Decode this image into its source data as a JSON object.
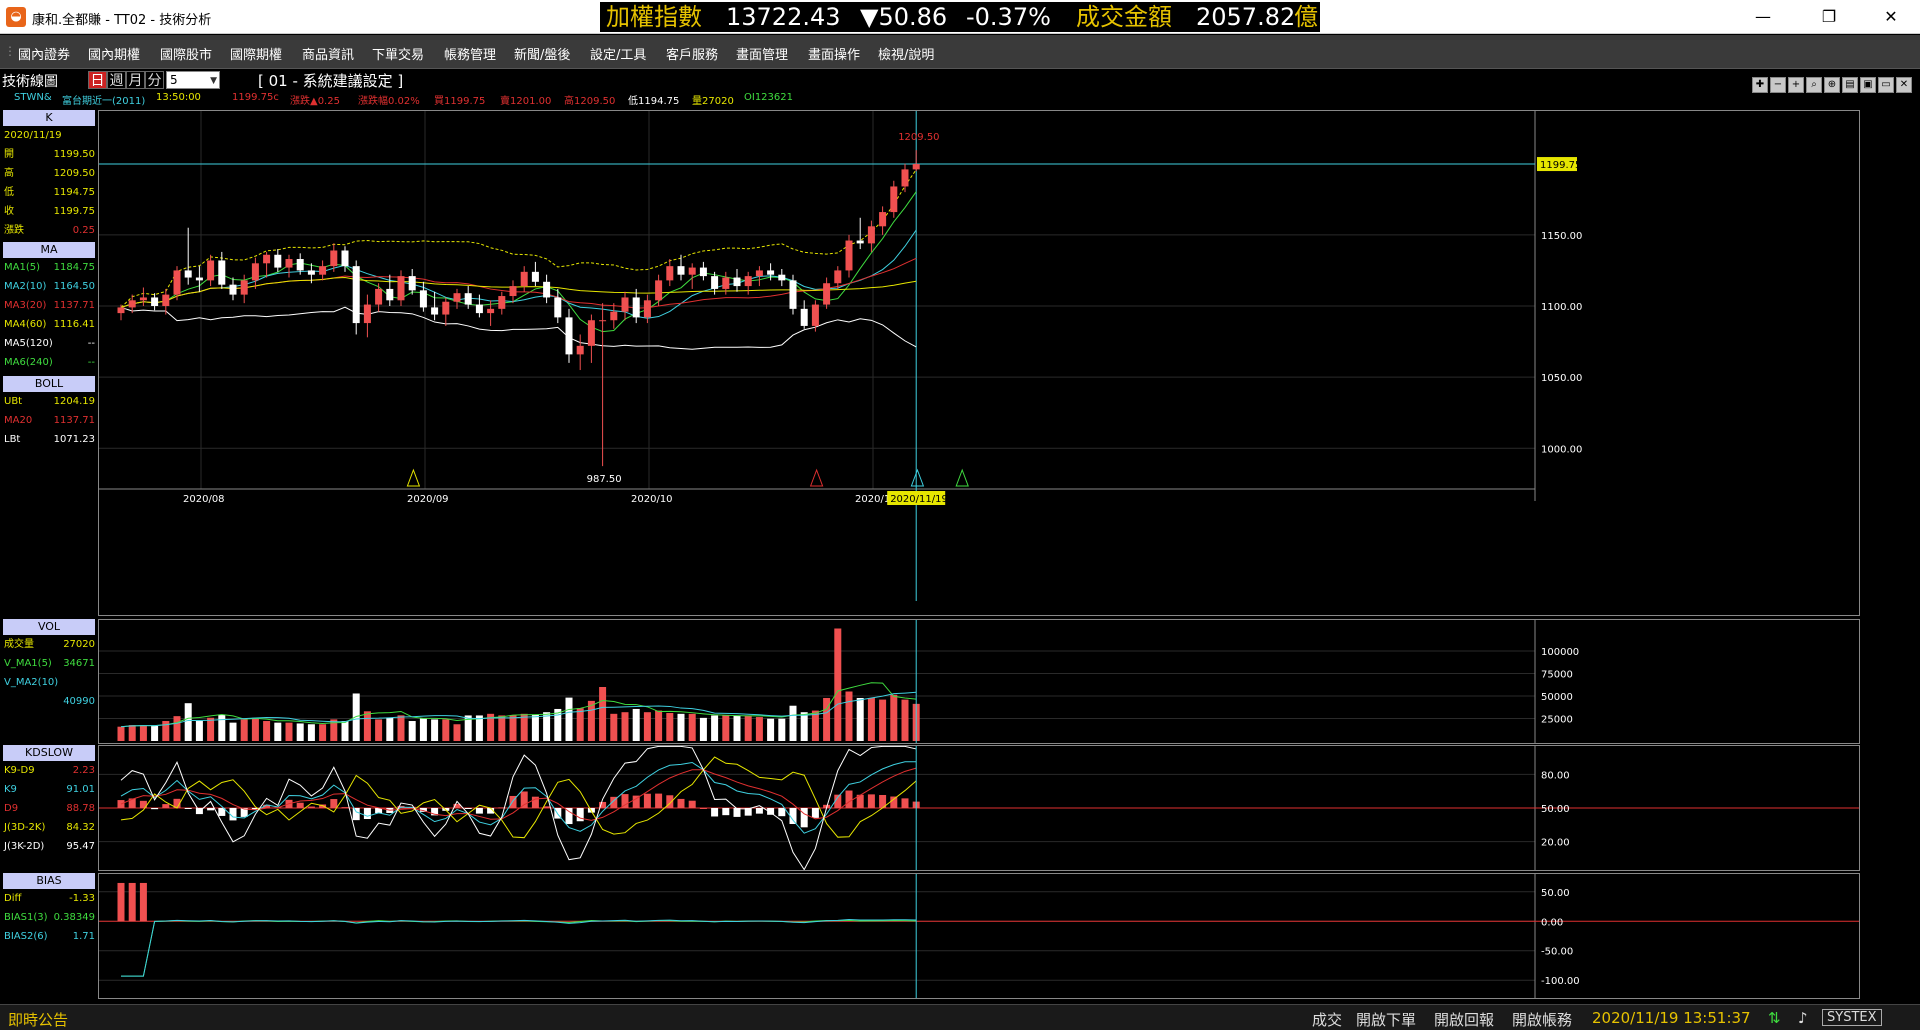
{
  "window": {
    "title": "康和.全都賺 - TT02 - 技術分析",
    "app_icon": "app-logo-icon",
    "controls": {
      "minimize": "—",
      "restore": "❐",
      "close": "✕"
    }
  },
  "ticker": {
    "index_name": "加權指數",
    "index_value": "13722.43",
    "change": "▼50.86",
    "change_pct": "-0.37%",
    "volume_label": "成交金額",
    "volume_value": "2057.82",
    "volume_unit": "億"
  },
  "menu": [
    "國內證券",
    "國內期權",
    "國際股市",
    "國際期權",
    "商品資訊",
    "下單交易",
    "帳務管理",
    "新聞/盤後",
    "設定/工具",
    "客戶服務",
    "畫面管理",
    "畫面操作",
    "檢視/說明"
  ],
  "toolbar": {
    "title": "技術線圖",
    "periods": [
      "日",
      "週",
      "月",
      "分"
    ],
    "selected_period": "日",
    "minute_value": "5",
    "setting": "[ 01 - 系統建議設定 ]"
  },
  "info": {
    "symbol": "STWN&",
    "name": "富台期近一(2011)",
    "time": "13:50:00",
    "price": "1199.75c",
    "chg": "漲跌▲0.25",
    "chg_pct": "漲跌幅0.02%",
    "bid": "買1199.75",
    "ask": "賣1201.00",
    "high": "高1209.50",
    "low": "低1194.75",
    "vol": "量27020",
    "oi": "OI123621"
  },
  "panel_k": {
    "head": "K",
    "date": "2020/11/19",
    "rows": [
      {
        "label": "開",
        "value": "1199.50"
      },
      {
        "label": "高",
        "value": "1209.50"
      },
      {
        "label": "低",
        "value": "1194.75"
      },
      {
        "label": "收",
        "value": "1199.75"
      },
      {
        "label": "漲跌",
        "value": "0.25"
      }
    ]
  },
  "panel_ma": {
    "head": "MA",
    "rows": [
      {
        "label": "MA1(5)",
        "value": "1184.75",
        "color": "#3fdc3f"
      },
      {
        "label": "MA2(10)",
        "value": "1164.50",
        "color": "#3fd0e0"
      },
      {
        "label": "MA3(20)",
        "value": "1137.71",
        "color": "#e03030"
      },
      {
        "label": "MA4(60)",
        "value": "1116.41",
        "color": "#e6e600"
      },
      {
        "label": "MA5(120)",
        "value": "--",
        "color": "#ffffff"
      },
      {
        "label": "MA6(240)",
        "value": "--",
        "color": "#3fdc3f"
      }
    ]
  },
  "panel_boll": {
    "head": "BOLL",
    "rows": [
      {
        "label": "UBt",
        "value": "1204.19",
        "color": "#e6e600"
      },
      {
        "label": "MA20",
        "value": "1137.71",
        "color": "#e03030"
      },
      {
        "label": "LBt",
        "value": "1071.23",
        "color": "#ffffff"
      }
    ]
  },
  "panel_vol": {
    "head": "VOL",
    "rows": [
      {
        "label": "成交量",
        "value": "27020",
        "color": "#e6e600"
      },
      {
        "label": "V_MA1(5)",
        "value": "34671",
        "color": "#3fdc3f"
      },
      {
        "label": "V_MA2(10)",
        "value": "",
        "color": "#3fd0e0"
      },
      {
        "label": "",
        "value": "40990",
        "color": "#3fd0e0"
      }
    ]
  },
  "panel_kd": {
    "head": "KDSLOW",
    "rows": [
      {
        "label": "K9-D9",
        "value": "2.23",
        "color": "#e03030"
      },
      {
        "label": "K9",
        "value": "91.01",
        "color": "#3fd0e0"
      },
      {
        "label": "D9",
        "value": "88.78",
        "color": "#e03030"
      },
      {
        "label": "J(3D-2K)",
        "value": "84.32",
        "color": "#e6e600"
      },
      {
        "label": "J(3K-2D)",
        "value": "95.47",
        "color": "#ffffff"
      }
    ]
  },
  "panel_bias": {
    "head": "BIAS",
    "rows": [
      {
        "label": "Diff",
        "value": "-1.33",
        "color": "#e6e600"
      },
      {
        "label": "BIAS1(3)",
        "value": "0.38349",
        "color": "#3fdc3f"
      },
      {
        "label": "BIAS2(6)",
        "value": "1.71",
        "color": "#3fd0e0"
      }
    ]
  },
  "price_chart": {
    "y_ticks": [
      "1150.00",
      "1100.00",
      "1050.00",
      "1000.00"
    ],
    "y_tick_values": [
      1150,
      1100,
      1050,
      1000
    ],
    "y_range": [
      970,
      1230
    ],
    "x_labels": [
      "2020/08",
      "2020/09",
      "2020/10",
      "2020/11"
    ],
    "cursor_date": "2020/11/19",
    "last_price_tag": "1199.75",
    "high_label": "1209.50",
    "low_label": "987.50"
  },
  "vol_chart": {
    "y_ticks": [
      "100000",
      "75000",
      "50000",
      "25000"
    ],
    "y_tick_values": [
      100000,
      75000,
      50000,
      25000
    ],
    "y_max": 130000
  },
  "kd_chart": {
    "y_ticks": [
      "80.00",
      "50.00",
      "20.00"
    ],
    "y_tick_values": [
      80,
      50,
      20
    ]
  },
  "bias_chart": {
    "y_ticks": [
      "50.00",
      "0.00",
      "-50.00",
      "-100.00"
    ],
    "y_tick_values": [
      50,
      0,
      -50,
      -100
    ]
  },
  "chart_data": {
    "type": "candlestick",
    "note_series": "daily OHLC of 富台期近一",
    "candles": [
      [
        1095,
        1101,
        1090,
        1099
      ],
      [
        1099,
        1108,
        1095,
        1104
      ],
      [
        1104,
        1113,
        1100,
        1106
      ],
      [
        1106,
        1109,
        1097,
        1100
      ],
      [
        1100,
        1112,
        1094,
        1108
      ],
      [
        1108,
        1128,
        1104,
        1125
      ],
      [
        1125,
        1155,
        1115,
        1120
      ],
      [
        1120,
        1128,
        1110,
        1118
      ],
      [
        1118,
        1136,
        1114,
        1132
      ],
      [
        1132,
        1138,
        1112,
        1115
      ],
      [
        1115,
        1120,
        1104,
        1108
      ],
      [
        1108,
        1122,
        1102,
        1118
      ],
      [
        1118,
        1134,
        1112,
        1130
      ],
      [
        1130,
        1138,
        1120,
        1136
      ],
      [
        1136,
        1140,
        1124,
        1127
      ],
      [
        1127,
        1136,
        1120,
        1133
      ],
      [
        1133,
        1137,
        1122,
        1125
      ],
      [
        1125,
        1130,
        1116,
        1122
      ],
      [
        1122,
        1132,
        1118,
        1128
      ],
      [
        1128,
        1144,
        1124,
        1139
      ],
      [
        1139,
        1142,
        1124,
        1128
      ],
      [
        1128,
        1132,
        1080,
        1088
      ],
      [
        1088,
        1108,
        1078,
        1101
      ],
      [
        1101,
        1116,
        1096,
        1112
      ],
      [
        1112,
        1122,
        1100,
        1104
      ],
      [
        1104,
        1125,
        1100,
        1121
      ],
      [
        1121,
        1126,
        1108,
        1111
      ],
      [
        1111,
        1117,
        1096,
        1099
      ],
      [
        1099,
        1110,
        1090,
        1094
      ],
      [
        1094,
        1106,
        1086,
        1103
      ],
      [
        1103,
        1112,
        1098,
        1109
      ],
      [
        1109,
        1114,
        1098,
        1101
      ],
      [
        1101,
        1108,
        1092,
        1095
      ],
      [
        1095,
        1104,
        1086,
        1098
      ],
      [
        1098,
        1110,
        1094,
        1107
      ],
      [
        1107,
        1118,
        1102,
        1114
      ],
      [
        1114,
        1128,
        1110,
        1124
      ],
      [
        1124,
        1131,
        1114,
        1117
      ],
      [
        1117,
        1122,
        1102,
        1106
      ],
      [
        1106,
        1112,
        1088,
        1092
      ],
      [
        1092,
        1098,
        1060,
        1066
      ],
      [
        1066,
        1080,
        1055,
        1072
      ],
      [
        1072,
        1094,
        1060,
        1090
      ],
      [
        1090,
        1102,
        987.5,
        1090
      ],
      [
        1090,
        1102,
        1084,
        1096
      ],
      [
        1096,
        1110,
        1090,
        1106
      ],
      [
        1106,
        1112,
        1088,
        1092
      ],
      [
        1092,
        1108,
        1088,
        1104
      ],
      [
        1104,
        1122,
        1100,
        1118
      ],
      [
        1118,
        1133,
        1114,
        1128
      ],
      [
        1128,
        1136,
        1118,
        1122
      ],
      [
        1122,
        1130,
        1112,
        1127
      ],
      [
        1127,
        1131,
        1118,
        1121
      ],
      [
        1121,
        1124,
        1108,
        1112
      ],
      [
        1112,
        1124,
        1108,
        1120
      ],
      [
        1120,
        1126,
        1110,
        1114
      ],
      [
        1114,
        1124,
        1108,
        1121
      ],
      [
        1121,
        1128,
        1114,
        1125
      ],
      [
        1125,
        1130,
        1118,
        1122
      ],
      [
        1122,
        1126,
        1114,
        1118
      ],
      [
        1118,
        1122,
        1094,
        1098
      ],
      [
        1098,
        1104,
        1084,
        1086
      ],
      [
        1086,
        1104,
        1082,
        1101
      ],
      [
        1101,
        1120,
        1098,
        1116
      ],
      [
        1116,
        1128,
        1112,
        1125
      ],
      [
        1125,
        1150,
        1120,
        1146
      ],
      [
        1146,
        1162,
        1140,
        1144
      ],
      [
        1144,
        1160,
        1138,
        1156
      ],
      [
        1156,
        1170,
        1150,
        1166
      ],
      [
        1166,
        1188,
        1162,
        1184
      ],
      [
        1184,
        1200,
        1180,
        1196
      ],
      [
        1196,
        1209.5,
        1194.75,
        1199.75
      ]
    ]
  }
}
